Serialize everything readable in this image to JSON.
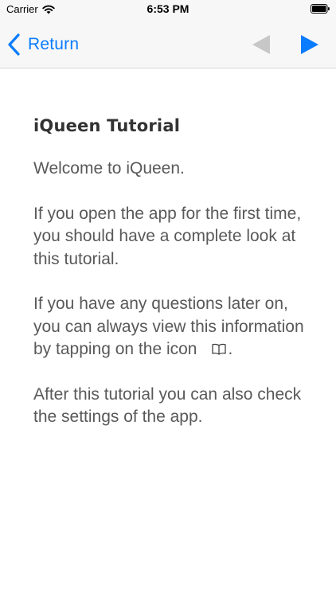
{
  "status_bar": {
    "carrier": "Carrier",
    "time": "6:53 PM"
  },
  "nav": {
    "back_label": "Return",
    "accent_color": "#0a7cff",
    "disabled_color": "#c7c7c7",
    "prev_icon": "triangle-left-icon",
    "next_icon": "triangle-right-icon"
  },
  "content": {
    "title": "iQueen Tutorial",
    "paragraphs": [
      "Welcome to iQueen.",
      "If you open the app for the first time, you should have a complete look at this tutorial."
    ],
    "icon_paragraph": {
      "before": "If you have any questions later on, you can always view this information by tapping on the icon",
      "icon": "book-icon",
      "after": "."
    },
    "final_paragraph": "After this tutorial you can also check the settings of the app."
  }
}
